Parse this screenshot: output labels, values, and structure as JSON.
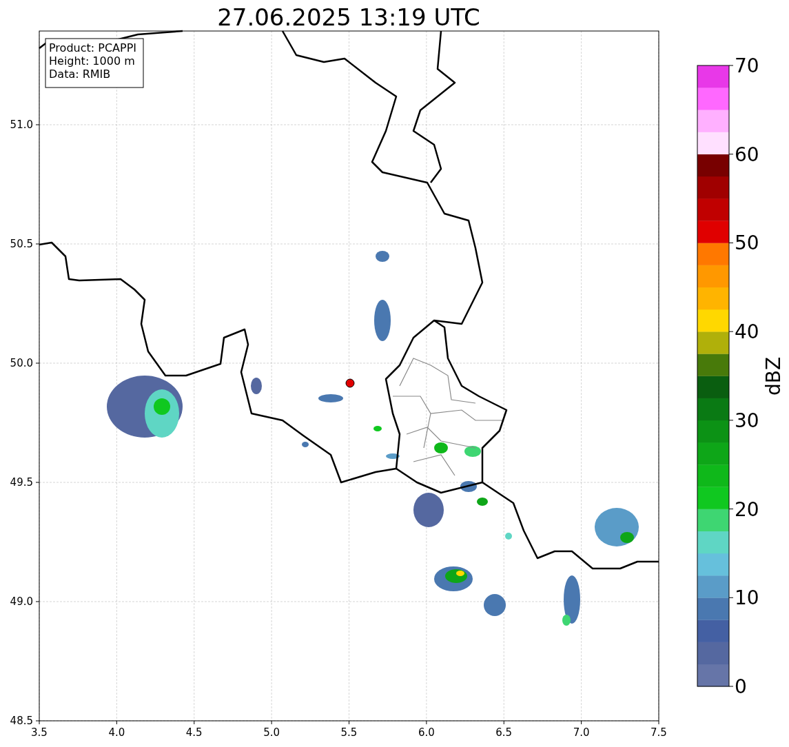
{
  "title": "27.06.2025 13:19 UTC",
  "info_box": [
    "Product: PCAPPI",
    "Height: 1000 m",
    "Data: RMIB"
  ],
  "x_ticks": [
    "3.5",
    "4.0",
    "4.5",
    "5.0",
    "5.5",
    "6.0",
    "6.5",
    "7.0",
    "7.5"
  ],
  "y_ticks": [
    "51.0",
    "50.5",
    "50.0",
    "49.5",
    "49.0",
    "48.5"
  ],
  "colorbar": {
    "label": "dBZ",
    "ticks": [
      "70",
      "60",
      "50",
      "40",
      "30",
      "20",
      "10",
      "0"
    ],
    "segments": [
      {
        "color": "#6675a8"
      },
      {
        "color": "#5568a0"
      },
      {
        "color": "#4460a3"
      },
      {
        "color": "#4a78b0"
      },
      {
        "color": "#5a9cc8"
      },
      {
        "color": "#66c0dc"
      },
      {
        "color": "#5fd6c4"
      },
      {
        "color": "#3ed672"
      },
      {
        "color": "#10c820"
      },
      {
        "color": "#0fb81a"
      },
      {
        "color": "#0ea618"
      },
      {
        "color": "#0c9215"
      },
      {
        "color": "#0a7a14"
      },
      {
        "color": "#0a5e10"
      },
      {
        "color": "#487a0a"
      },
      {
        "color": "#b0b00a"
      },
      {
        "color": "#ffd800"
      },
      {
        "color": "#ffb400"
      },
      {
        "color": "#ff9800"
      },
      {
        "color": "#ff7800"
      },
      {
        "color": "#e00000"
      },
      {
        "color": "#c00000"
      },
      {
        "color": "#a00000"
      },
      {
        "color": "#780000"
      },
      {
        "color": "#ffe0ff"
      },
      {
        "color": "#ffb0ff"
      },
      {
        "color": "#ff68ff"
      },
      {
        "color": "#e838e8"
      }
    ]
  }
}
